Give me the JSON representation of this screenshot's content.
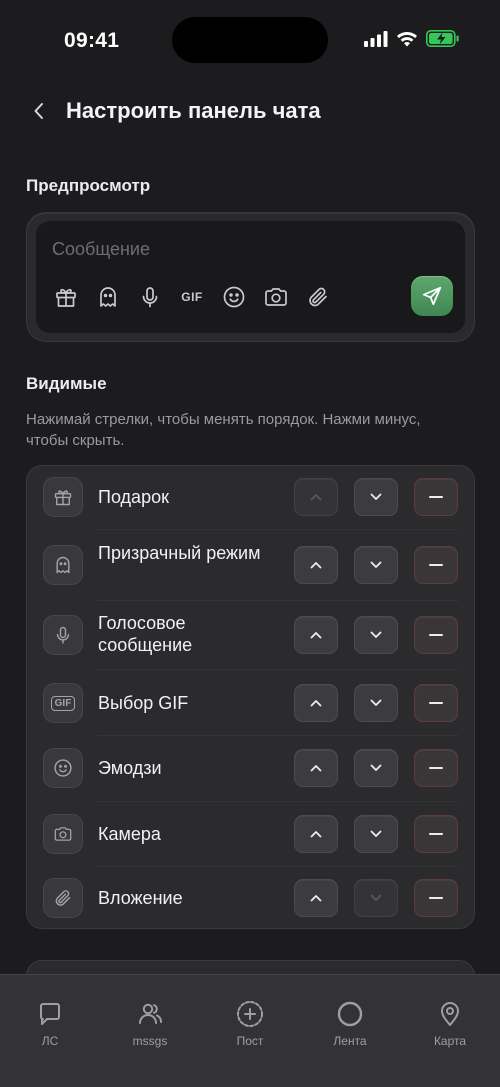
{
  "status_bar": {
    "time": "09:41"
  },
  "header": {
    "title": "Настроить панель чата"
  },
  "preview": {
    "section_title": "Предпросмотр",
    "placeholder": "Сообщение",
    "gif_label": "GIF",
    "send_color": "#4f9a61"
  },
  "visible": {
    "section_title": "Видимые",
    "hint": "Нажимай стрелки, чтобы менять порядок. Нажми минус, чтобы скрыть.",
    "items": [
      {
        "label": "Подарок",
        "icon": "gift-icon",
        "up_enabled": false,
        "down_enabled": true
      },
      {
        "label": "Призрачный режим",
        "icon": "ghost-icon",
        "up_enabled": true,
        "down_enabled": true
      },
      {
        "label": "Голосовое сообщение",
        "icon": "microphone-icon",
        "up_enabled": true,
        "down_enabled": true
      },
      {
        "label": "Выбор GIF",
        "icon": "gif-icon",
        "icon_text": "GIF",
        "up_enabled": true,
        "down_enabled": true
      },
      {
        "label": "Эмодзи",
        "icon": "emoji-icon",
        "up_enabled": true,
        "down_enabled": true
      },
      {
        "label": "Камера",
        "icon": "camera-icon",
        "up_enabled": true,
        "down_enabled": true
      },
      {
        "label": "Вложение",
        "icon": "paperclip-icon",
        "up_enabled": true,
        "down_enabled": false
      }
    ]
  },
  "tab_bar": {
    "tabs": [
      {
        "label": "ЛС",
        "icon": "chat-bubble-icon"
      },
      {
        "label": "mssgs",
        "icon": "users-icon"
      },
      {
        "label": "Пост",
        "icon": "plus-circle-icon"
      },
      {
        "label": "Лента",
        "icon": "circle-icon"
      },
      {
        "label": "Карта",
        "icon": "map-pin-icon"
      }
    ]
  }
}
